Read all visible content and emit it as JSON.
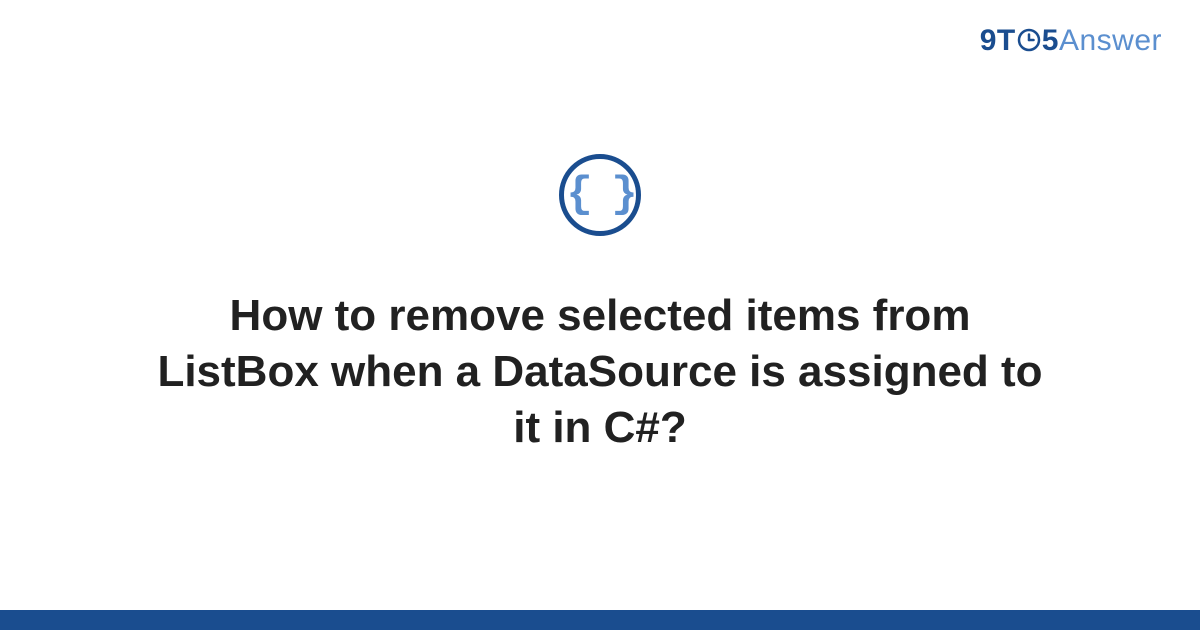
{
  "logo": {
    "part1": "9T",
    "part2": "5",
    "part3": "Answer",
    "icon_label": "clock"
  },
  "badge": {
    "symbol": "{ }",
    "icon_label": "code-braces"
  },
  "question": {
    "title": "How to remove selected items from ListBox when a DataSource is assigned to it in C#?"
  },
  "colors": {
    "primary": "#1a4d8f",
    "secondary": "#5b8fcf",
    "text": "#212121",
    "background": "#ffffff"
  }
}
